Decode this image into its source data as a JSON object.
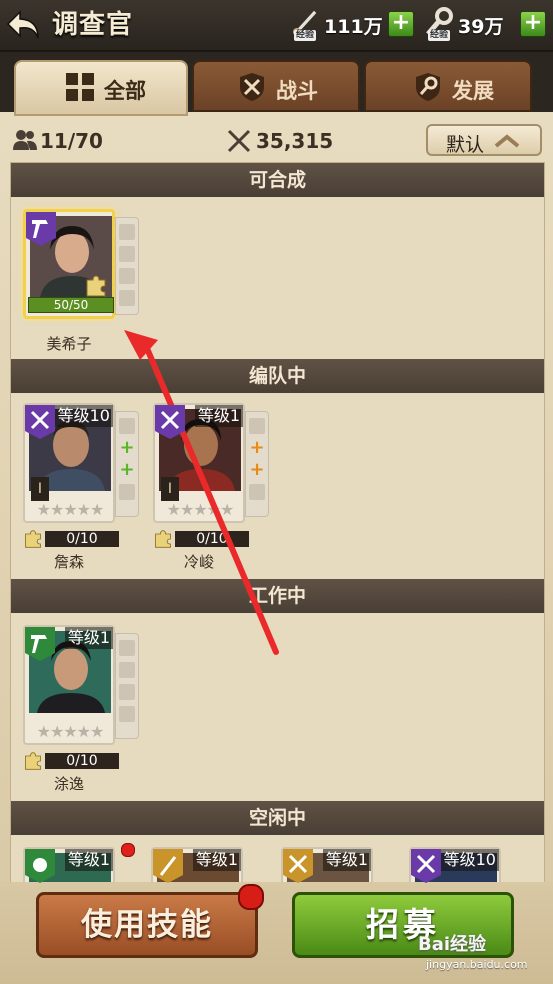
{
  "header": {
    "title": "调查官",
    "resources": [
      {
        "tag": "经验",
        "value": "111万"
      },
      {
        "tag": "经验",
        "value": "39万"
      }
    ]
  },
  "tabs": [
    {
      "label": "全部",
      "active": true
    },
    {
      "label": "战斗",
      "active": false
    },
    {
      "label": "发展",
      "active": false
    }
  ],
  "stats": {
    "count": "11/70",
    "power": "35,315"
  },
  "sort": {
    "label": "默认"
  },
  "sections": {
    "combinable": "可合成",
    "in_team": "编队中",
    "working": "工作中",
    "idle": "空闲中"
  },
  "cards": {
    "mei": {
      "name": "美希子",
      "hp": "50/50"
    },
    "zhan": {
      "name": "詹森",
      "level": "等级10",
      "rank": "I",
      "fragments": "0/10",
      "stars_filled": 0
    },
    "leng": {
      "name": "冷峻",
      "level": "等级1",
      "rank": "I",
      "fragments": "0/10",
      "stars_filled": 0
    },
    "tu": {
      "name": "涂逸",
      "level": "等级1",
      "fragments": "0/10",
      "stars_filled": 0
    },
    "idle1": {
      "level": "等级1"
    },
    "idle2": {
      "level": "等级1"
    },
    "idle3": {
      "level": "等级1"
    },
    "idle4": {
      "level": "等级10"
    }
  },
  "stars_row": "★★★★★",
  "buttons": {
    "use_skill": "使用技能",
    "recruit": "招募"
  },
  "watermark": {
    "brand": "Bai经验",
    "url": "jingyan.baidu.com"
  },
  "colors": {
    "accent_green": "#5c8f22",
    "accent_red": "#e0201a",
    "purple_class": "#6a3aa8",
    "gold_class": "#c9952a",
    "green_class": "#2e8a3a"
  }
}
